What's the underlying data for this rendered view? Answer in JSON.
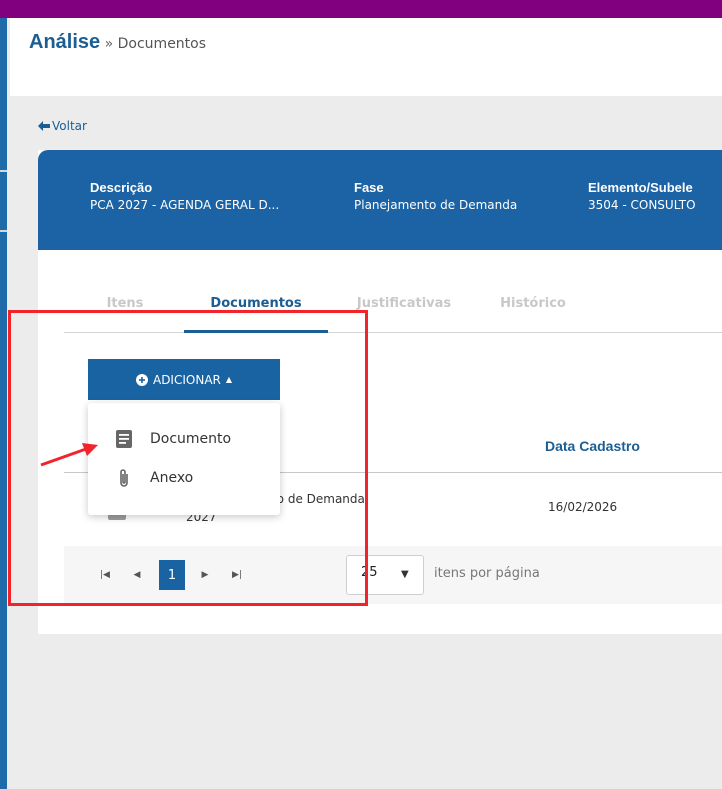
{
  "breadcrumb": {
    "title": "Análise",
    "separator": "»",
    "current": "Documentos"
  },
  "back_link": "Voltar",
  "summary": {
    "fields": [
      {
        "label": "Descrição",
        "value": "PCA 2027 - AGENDA GERAL D..."
      },
      {
        "label": "Fase",
        "value": "Planejamento de Demanda"
      },
      {
        "label": "Elemento/Subele",
        "value": "3504 - CONSULTO"
      }
    ]
  },
  "tabs": [
    "Itens",
    "Documentos",
    "Justificativas",
    "Histórico"
  ],
  "active_tab": "Documentos",
  "add_button": {
    "label": "ADICIONAR"
  },
  "add_menu": {
    "items": [
      {
        "label": "Documento",
        "icon": "document-icon"
      },
      {
        "label": "Anexo",
        "icon": "paperclip-icon"
      }
    ]
  },
  "table": {
    "columns": [
      "Data Cadastro"
    ],
    "rows": [
      {
        "name_line1": "de Formalização de Demanda",
        "name_line2": "2027",
        "date": "16/02/2026"
      }
    ]
  },
  "pagination": {
    "current_page": "1",
    "page_size": "25",
    "per_page_label": "itens por página"
  },
  "colors": {
    "brand": "#1b63a5",
    "accent_top": "#800080",
    "annotation": "#f2232a"
  }
}
